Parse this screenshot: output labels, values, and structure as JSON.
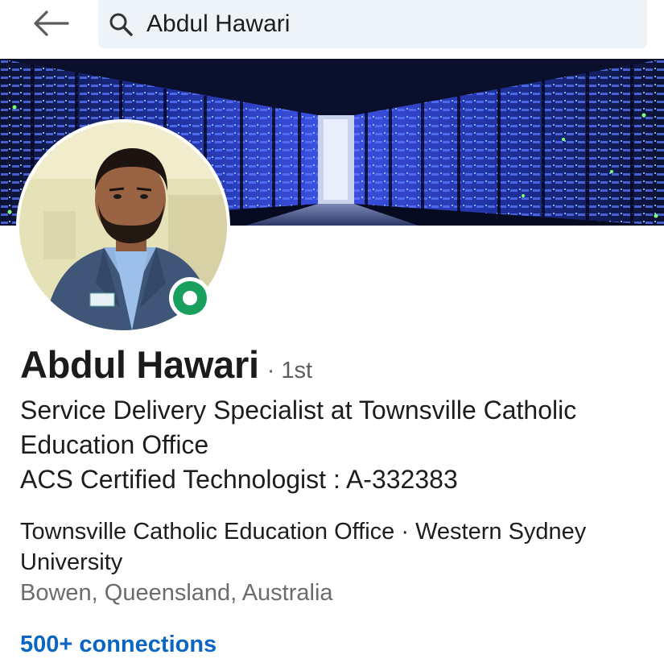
{
  "search": {
    "value": "Abdul Hawari"
  },
  "icons": {
    "back": "arrow-left-icon",
    "search": "magnifier-icon",
    "presence": "online-status-icon"
  },
  "profile": {
    "name": "Abdul Hawari",
    "degree": "· 1st",
    "headline_lines": [
      "Service Delivery Specialist at Townsville Catholic",
      "Education Office",
      "ACS Certified Technologist : A-332383"
    ],
    "organizations": "Townsville Catholic Education Office · Western Sydney University",
    "location": "Bowen, Queensland, Australia",
    "connections": "500+ connections"
  },
  "colors": {
    "link_blue": "#0a66c2",
    "presence_green": "#19a05f",
    "search_bg": "#eef3f8",
    "secondary_text": "#6c6c6c"
  }
}
